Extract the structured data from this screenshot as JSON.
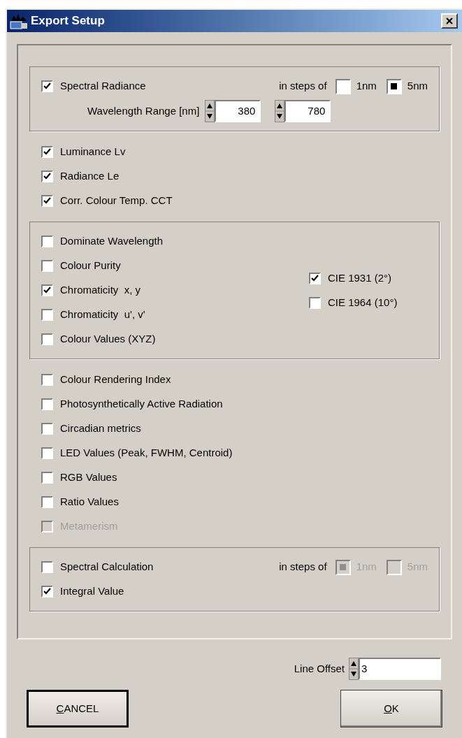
{
  "window": {
    "title": "Export Setup"
  },
  "spectral_group": {
    "checkbox": {
      "label": "Spectral Radiance",
      "checked": true
    },
    "steps_label": "in steps of",
    "steps": [
      {
        "label": "1nm",
        "selected": false,
        "disabled": false
      },
      {
        "label": "5nm",
        "selected": true,
        "disabled": false
      }
    ],
    "range_label": "Wavelength Range [nm]",
    "range": [
      "380",
      "780"
    ]
  },
  "options": [
    {
      "label": "Luminance Lv",
      "checked": true
    },
    {
      "label": "Radiance Le",
      "checked": true
    },
    {
      "label": "Corr. Colour Temp. CCT",
      "checked": true
    }
  ],
  "chromaticity_group": {
    "options": [
      {
        "label": "Dominate Wavelength",
        "checked": false
      },
      {
        "label": "Colour Purity",
        "checked": false
      },
      {
        "label": "Chromaticity  x, y",
        "checked": true
      },
      {
        "label": "Chromaticity  u', v'",
        "checked": false
      },
      {
        "label": "Colour Values (XYZ)",
        "checked": false
      }
    ],
    "observers": [
      {
        "label": "CIE 1931 (2°)",
        "checked": true
      },
      {
        "label": "CIE 1964 (10°)",
        "checked": false
      }
    ]
  },
  "more_options": [
    {
      "label": "Colour Rendering Index",
      "checked": false,
      "disabled": false
    },
    {
      "label": "Photosynthetically Active Radiation",
      "checked": false,
      "disabled": false
    },
    {
      "label": "Circadian metrics",
      "checked": false,
      "disabled": false
    },
    {
      "label": "LED Values (Peak, FWHM, Centroid)",
      "checked": false,
      "disabled": false
    },
    {
      "label": "RGB Values",
      "checked": false,
      "disabled": false
    },
    {
      "label": "Ratio Values",
      "checked": false,
      "disabled": false
    },
    {
      "label": "Metamerism",
      "checked": false,
      "disabled": true
    }
  ],
  "calculation_group": {
    "options": [
      {
        "label": "Spectral Calculation",
        "checked": false
      },
      {
        "label": "Integral Value",
        "checked": true
      }
    ],
    "steps_label": "in steps of",
    "steps": [
      {
        "label": "1nm",
        "selected": true,
        "disabled": true
      },
      {
        "label": "5nm",
        "selected": false,
        "disabled": true
      }
    ]
  },
  "line_offset": {
    "label": "Line Offset",
    "value": "3"
  },
  "buttons": [
    {
      "label": "CANCEL",
      "default": true
    },
    {
      "label": "OK",
      "default": false
    }
  ]
}
